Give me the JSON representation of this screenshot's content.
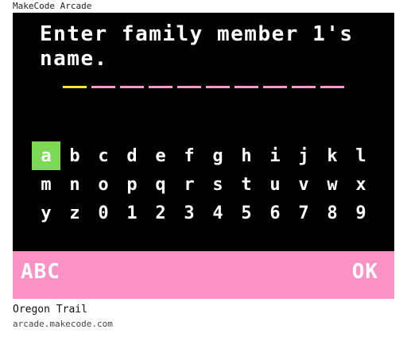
{
  "app": {
    "title": "MakeCode Arcade"
  },
  "screen": {
    "prompt": "Enter family member 1's name.",
    "name_slots": {
      "count": 10,
      "active_index": 0
    },
    "keyboard": {
      "rows": [
        [
          "a",
          "b",
          "c",
          "d",
          "e",
          "f",
          "g",
          "h",
          "i",
          "j",
          "k",
          "l"
        ],
        [
          "m",
          "n",
          "o",
          "p",
          "q",
          "r",
          "s",
          "t",
          "u",
          "v",
          "w",
          "x"
        ],
        [
          "y",
          "z",
          "0",
          "1",
          "2",
          "3",
          "4",
          "5",
          "6",
          "7",
          "8",
          "9"
        ]
      ],
      "selected_key": "a"
    },
    "footer": {
      "mode_label": "ABC",
      "ok_label": "OK"
    }
  },
  "game": {
    "title": "Oregon Trail",
    "url": "arcade.makecode.com"
  },
  "colors": {
    "screen_bg": "#000000",
    "footer_bg": "#fa92c5",
    "selected_key_bg": "#7ed957",
    "active_slot": "#f5e82b",
    "slot": "#f49ac9"
  }
}
